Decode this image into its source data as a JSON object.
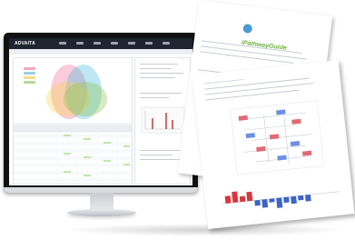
{
  "monitor": {
    "app_name": "ADVAITA",
    "theme_dark": "#1f2430",
    "venn_colors": [
      "#f06a98",
      "#43b9d9",
      "#f5d84b",
      "#8bc34a"
    ]
  },
  "paper1": {
    "logo_text": "iPathwayGuide",
    "logo_green": "#6bb23f",
    "logo_blue": "#4a9ad4"
  },
  "paper2": {
    "bar_colors": [
      "#d9363e",
      "#3b64c8"
    ]
  }
}
